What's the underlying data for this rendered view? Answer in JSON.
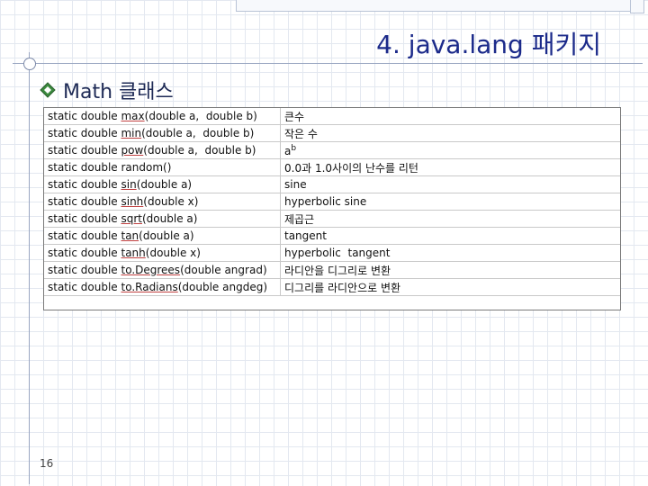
{
  "slide": {
    "title": "4. java.lang 패키지",
    "subtitle": "Math 클래스",
    "page_number": "16"
  },
  "table": {
    "rows": [
      {
        "prefix": "static double ",
        "method": "max",
        "args": "(double a,  double b)",
        "desc": "큰수"
      },
      {
        "prefix": "static double ",
        "method": "min",
        "args": "(double a,  double b)",
        "desc": "작은 수"
      },
      {
        "prefix": "static double ",
        "method": "pow",
        "args": "(double a,  double b)",
        "desc": "a",
        "sup": "b"
      },
      {
        "prefix": "static double ",
        "method": "random",
        "args": "()",
        "desc": "0.0과 1.0사이의 난수를 리턴",
        "plain": true
      },
      {
        "prefix": "static double ",
        "method": "sin",
        "args": "(double a)",
        "desc": "sine"
      },
      {
        "prefix": "static double ",
        "method": "sinh",
        "args": "(double x)",
        "desc": "hyperbolic sine"
      },
      {
        "prefix": "static double ",
        "method": "sqrt",
        "args": "(double a)",
        "desc": "제곱근"
      },
      {
        "prefix": "static double ",
        "method": "tan",
        "args": "(double a)",
        "desc": "tangent"
      },
      {
        "prefix": "static double ",
        "method": "tanh",
        "args": "(double x)",
        "desc": "hyperbolic  tangent"
      },
      {
        "prefix": "static double ",
        "method": "to.Degrees",
        "args": "(double angrad)",
        "desc": "라디안을 디그리로 변환"
      },
      {
        "prefix": "static double ",
        "method": "to.Radians",
        "args": "(double angdeg)",
        "desc": "디그리를 라디안으로 변환"
      }
    ]
  },
  "colors": {
    "title": "#1b2a8a",
    "bullet": "#3b8a3e",
    "grid": "#e3e8f0"
  },
  "icons": {
    "bullet": "diamond-bullet-icon"
  }
}
